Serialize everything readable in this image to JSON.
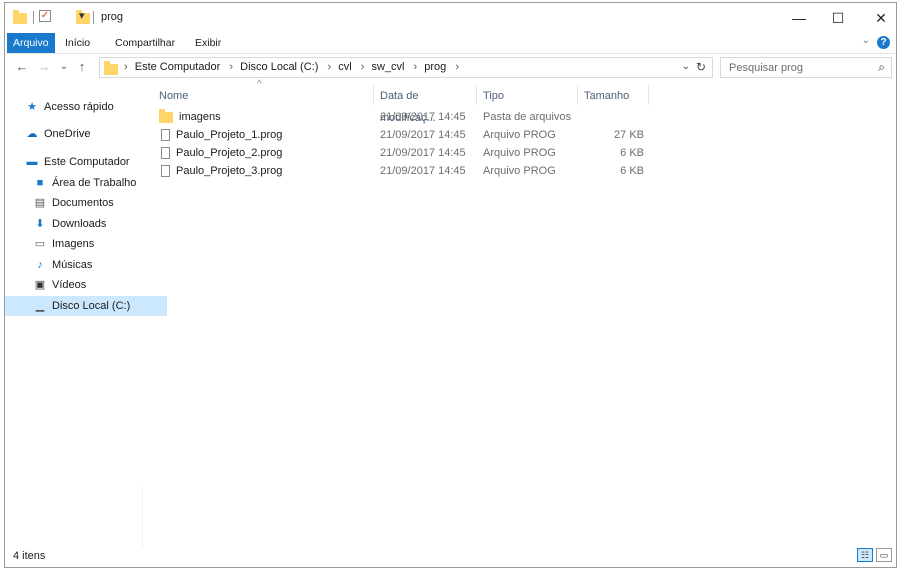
{
  "window": {
    "title": "prog",
    "minimize": "—",
    "maximize": "☐",
    "close": "✕"
  },
  "quick_access_toolbar": {
    "dropdown": "▾"
  },
  "ribbon": {
    "tabs": [
      {
        "label": "Arquivo",
        "active": true
      },
      {
        "label": "Início",
        "active": false
      },
      {
        "label": "Compartilhar",
        "active": false
      },
      {
        "label": "Exibir",
        "active": false
      }
    ],
    "help": "?",
    "collapse": "⌄"
  },
  "nav": {
    "back": "←",
    "forward": "→",
    "recent": "⌄",
    "up": "↑",
    "breadcrumbs": [
      "Este Computador",
      "Disco Local (C:)",
      "cvl",
      "sw_cvl",
      "prog"
    ],
    "crumb_sep": "›",
    "addr_dropdown": "⌄",
    "refresh": "↻",
    "search_placeholder": "Pesquisar prog",
    "search_icon": "⌕"
  },
  "sidebar": {
    "items": [
      {
        "label": "Acesso rápido",
        "icon": "star-icon",
        "glyph": "★",
        "color": "#1979ca"
      },
      {
        "label": "OneDrive",
        "icon": "cloud-icon",
        "glyph": "☁",
        "color": "#0f6bc5"
      },
      {
        "label": "Este Computador",
        "icon": "computer-icon",
        "glyph": "▬",
        "color": "#1979ca"
      },
      {
        "label": "Área de Trabalho",
        "icon": "desktop-icon",
        "glyph": "■",
        "color": "#1979ca"
      },
      {
        "label": "Documentos",
        "icon": "document-icon",
        "glyph": "▤",
        "color": "#555555"
      },
      {
        "label": "Downloads",
        "icon": "download-icon",
        "glyph": "⬇",
        "color": "#1979ca"
      },
      {
        "label": "Imagens",
        "icon": "pictures-icon",
        "glyph": "▭",
        "color": "#555555"
      },
      {
        "label": "Músicas",
        "icon": "music-icon",
        "glyph": "♪",
        "color": "#1979ca"
      },
      {
        "label": "Vídeos",
        "icon": "video-icon",
        "glyph": "▣",
        "color": "#333333"
      },
      {
        "label": "Disco Local (C:)",
        "icon": "drive-icon",
        "glyph": "▁",
        "color": "#555555",
        "selected": true
      }
    ]
  },
  "columns": [
    "Nome",
    "Data de modificaç...",
    "Tipo",
    "Tamanho"
  ],
  "sort_caret": "^",
  "files": [
    {
      "name": "imagens",
      "date": "21/09/2017 14:45",
      "type": "Pasta de arquivos",
      "size": "",
      "kind": "folder"
    },
    {
      "name": "Paulo_Projeto_1.prog",
      "date": "21/09/2017 14:45",
      "type": "Arquivo PROG",
      "size": "27 KB",
      "kind": "file"
    },
    {
      "name": "Paulo_Projeto_2.prog",
      "date": "21/09/2017 14:45",
      "type": "Arquivo PROG",
      "size": "6 KB",
      "kind": "file"
    },
    {
      "name": "Paulo_Projeto_3.prog",
      "date": "21/09/2017 14:45",
      "type": "Arquivo PROG",
      "size": "6 KB",
      "kind": "file"
    }
  ],
  "status": {
    "item_count": "4 itens",
    "details_view": "☷",
    "icons_view": "▭"
  },
  "colors": {
    "accent": "#1979ca",
    "selection": "#cce8ff",
    "folder": "#ffd568"
  }
}
